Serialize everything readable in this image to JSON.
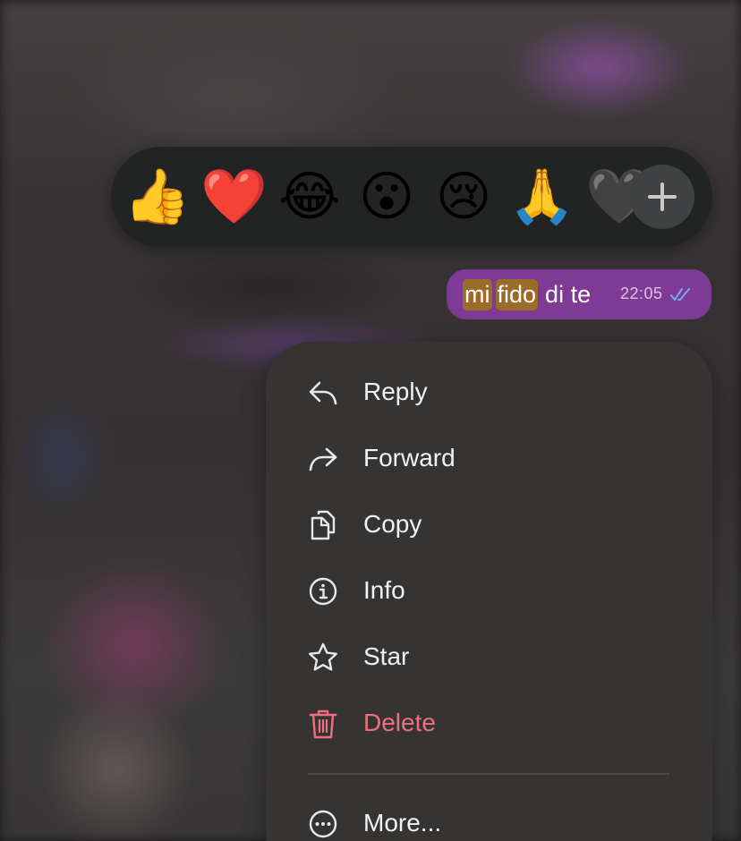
{
  "reactions": {
    "emojis": [
      "👍",
      "❤️",
      "😂",
      "😮",
      "😢",
      "🙏",
      "🖤"
    ],
    "more_icon": "plus-icon"
  },
  "message": {
    "words": [
      "mi",
      "fido",
      "di te"
    ],
    "time": "22:05",
    "status_icon": "double-check-icon",
    "bubble_color": "#7e3a94",
    "highlight_color": "#9b6b2a"
  },
  "menu": {
    "items": [
      {
        "label": "Reply",
        "icon": "reply-icon"
      },
      {
        "label": "Forward",
        "icon": "forward-icon"
      },
      {
        "label": "Copy",
        "icon": "copy-icon"
      },
      {
        "label": "Info",
        "icon": "info-icon"
      },
      {
        "label": "Star",
        "icon": "star-icon"
      },
      {
        "label": "Delete",
        "icon": "trash-icon",
        "color": "#ef6e84"
      },
      {
        "label": "More...",
        "icon": "more-icon"
      }
    ]
  }
}
